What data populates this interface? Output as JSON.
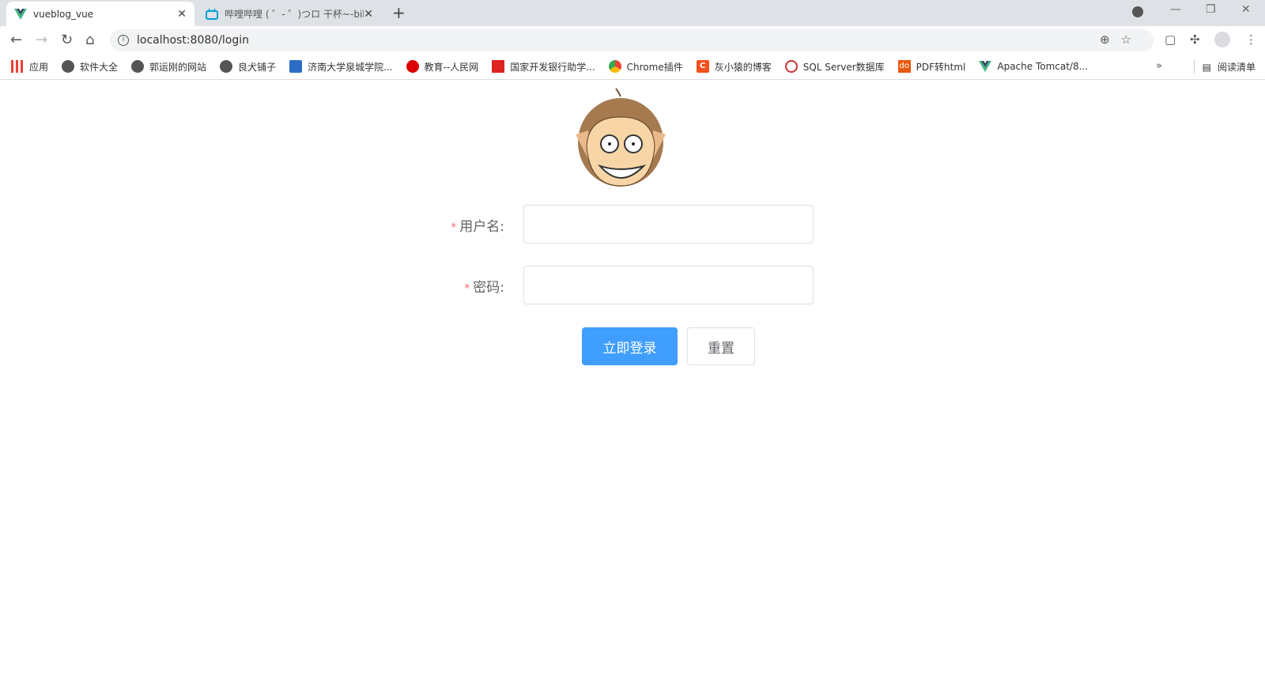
{
  "browser": {
    "tabs": [
      {
        "title": "vueblog_vue",
        "icon": "vue-logo-icon",
        "active": true
      },
      {
        "title": "哔哩哔哩 ( ゜- ゜)つロ 干杯~-bilibili",
        "icon": "bilibili-icon",
        "active": false
      }
    ],
    "url": "localhost:8080/login",
    "bookmarks": [
      {
        "label": "应用",
        "icon": "apps-grid-icon"
      },
      {
        "label": "软件大全",
        "icon": "globe-icon"
      },
      {
        "label": "郭运刚的网站",
        "icon": "globe-icon"
      },
      {
        "label": "良犬铺子",
        "icon": "globe-icon"
      },
      {
        "label": "济南大学泉城学院...",
        "icon": "school-icon"
      },
      {
        "label": "教育--人民网",
        "icon": "people-daily-icon"
      },
      {
        "label": "国家开发银行助学...",
        "icon": "bank-icon"
      },
      {
        "label": "Chrome插件",
        "icon": "chrome-plugin-icon"
      },
      {
        "label": "灰小猿的博客",
        "icon": "csdn-icon"
      },
      {
        "label": "SQL Server数据库",
        "icon": "sql-icon"
      },
      {
        "label": "PDF转html",
        "icon": "doc-icon"
      },
      {
        "label": "Apache Tomcat/8...",
        "icon": "vue-logo-icon"
      }
    ],
    "reading_list": "阅读清单"
  },
  "login": {
    "username_label": "用户名:",
    "password_label": "密码:",
    "required_mark": "*",
    "username_value": "",
    "password_value": "",
    "login_button": "立即登录",
    "reset_button": "重置",
    "primary_color": "#409eff"
  }
}
